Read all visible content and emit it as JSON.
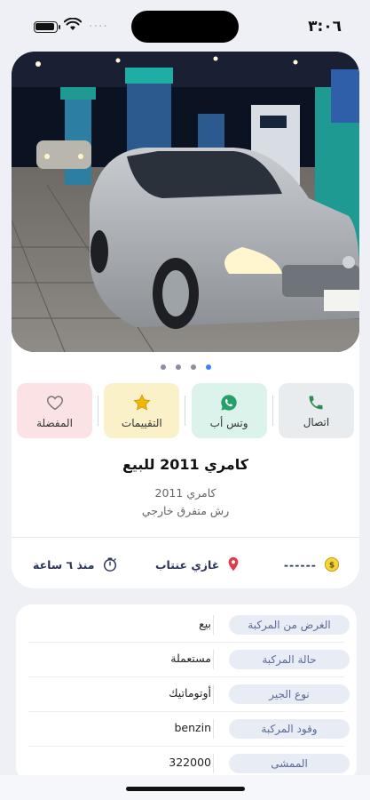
{
  "status_bar": {
    "time": "٣:٠٦",
    "signal_dots": "····"
  },
  "listing": {
    "photo_alt": "car-photo",
    "title": "كامري 2011 للبيع",
    "subtitle": "كامري 2011",
    "description": "رش متفرق خارجي",
    "price": "------",
    "location": "غازي عنتاب",
    "time_ago": "منذ ٦ ساعة",
    "carousel": {
      "count": 4,
      "active": 0
    }
  },
  "actions": [
    {
      "key": "call",
      "label": "اتصال",
      "icon": "phone-icon",
      "color": "#2e8b57"
    },
    {
      "key": "whatsapp",
      "label": "وتس أب",
      "icon": "whatsapp-icon",
      "color": "#25a06b"
    },
    {
      "key": "ratings",
      "label": "التقييمات",
      "icon": "star-icon",
      "color": "#f2b705"
    },
    {
      "key": "favorite",
      "label": "المفضلة",
      "icon": "heart-icon",
      "color": "#777777"
    }
  ],
  "details": [
    {
      "label": "الغرض من المركبة",
      "value": "بيع"
    },
    {
      "label": "حالة المركبة",
      "value": "مستعملة"
    },
    {
      "label": "نوع الجير",
      "value": "أوتوماتيك"
    },
    {
      "label": "وقود المركبة",
      "value": "benzin"
    },
    {
      "label": "الممشى",
      "value": "322000"
    }
  ],
  "colors": {
    "background": "#eef0f6",
    "accent": "#3b82f6",
    "location_pin": "#e23b4a",
    "price_coin": "#f5d33b",
    "tag_background": "#e8ecf5"
  }
}
